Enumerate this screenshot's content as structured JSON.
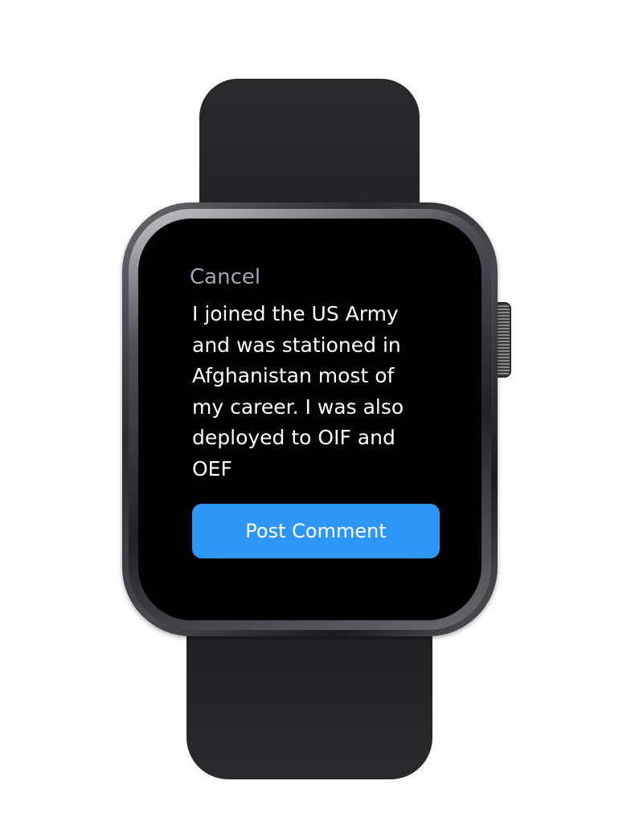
{
  "screen": {
    "cancel_label": "Cancel",
    "message_lines": [
      "I joined the US Army",
      "and was stationed in",
      "Afghanistan most of",
      "my career. I was also",
      "deployed to OIF and",
      "OEF"
    ],
    "post_button_label": "Post Comment"
  },
  "colors": {
    "accent": "#2e96f6",
    "cancel_text": "#a4a7b1",
    "screen_background": "#000000",
    "text": "#ffffff"
  },
  "icons": {
    "digital_crown": "digital-crown-icon",
    "side_button": "side-button-icon"
  }
}
